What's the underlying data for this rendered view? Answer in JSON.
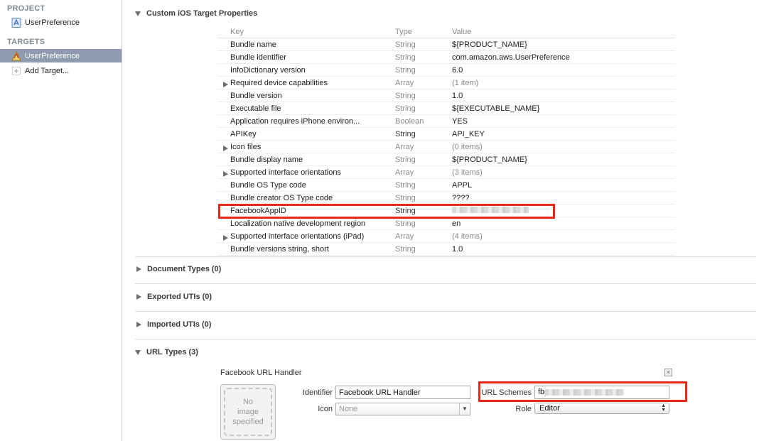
{
  "sidebar": {
    "project_header": "PROJECT",
    "project_item": "UserPreference",
    "targets_header": "TARGETS",
    "target_item": "UserPreference",
    "add_target": "Add Target..."
  },
  "properties": {
    "section_title": "Custom iOS Target Properties",
    "columns": {
      "key": "Key",
      "type": "Type",
      "value": "Value"
    },
    "rows": [
      {
        "key": "Bundle name",
        "type": "String",
        "value": "${PRODUCT_NAME}"
      },
      {
        "key": "Bundle identifier",
        "type": "String",
        "value": "com.amazon.aws.UserPreference"
      },
      {
        "key": "InfoDictionary version",
        "type": "String",
        "value": "6.0"
      },
      {
        "key": "Required device capabilities",
        "type": "Array",
        "value": "(1 item)"
      },
      {
        "key": "Bundle version",
        "type": "String",
        "value": "1.0"
      },
      {
        "key": "Executable file",
        "type": "String",
        "value": "${EXECUTABLE_NAME}"
      },
      {
        "key": "Application requires iPhone environ...",
        "type": "Boolean",
        "value": "YES"
      },
      {
        "key": "APIKey",
        "type": "String",
        "value": "API_KEY"
      },
      {
        "key": "Icon files",
        "type": "Array",
        "value": "(0 items)"
      },
      {
        "key": "Bundle display name",
        "type": "String",
        "value": "${PRODUCT_NAME}"
      },
      {
        "key": "Supported interface orientations",
        "type": "Array",
        "value": "(3 items)"
      },
      {
        "key": "Bundle OS Type code",
        "type": "String",
        "value": "APPL"
      },
      {
        "key": "Bundle creator OS Type code",
        "type": "String",
        "value": "????"
      },
      {
        "key": "FacebookAppID",
        "type": "String",
        "value": ""
      },
      {
        "key": "Localization native development region",
        "type": "String",
        "value": "en"
      },
      {
        "key": "Supported interface orientations (iPad)",
        "type": "Array",
        "value": "(4 items)"
      },
      {
        "key": "Bundle versions string, short",
        "type": "String",
        "value": "1.0"
      }
    ]
  },
  "sections": {
    "document_types": "Document Types (0)",
    "exported_utis": "Exported UTIs (0)",
    "imported_utis": "Imported UTIs (0)",
    "url_types": "URL Types (3)"
  },
  "url_handler": {
    "title": "Facebook URL Handler",
    "no_image": [
      "No",
      "image",
      "specified"
    ],
    "identifier_label": "Identifier",
    "identifier_value": "Facebook URL Handler",
    "icon_label": "Icon",
    "icon_placeholder": "None",
    "url_schemes_label": "URL Schemes",
    "url_schemes_value": "fb",
    "role_label": "Role",
    "role_value": "Editor"
  },
  "colors": {
    "selection": "#8f9bae",
    "highlight_box": "#e8281a",
    "muted_text": "#8a8a8a"
  }
}
